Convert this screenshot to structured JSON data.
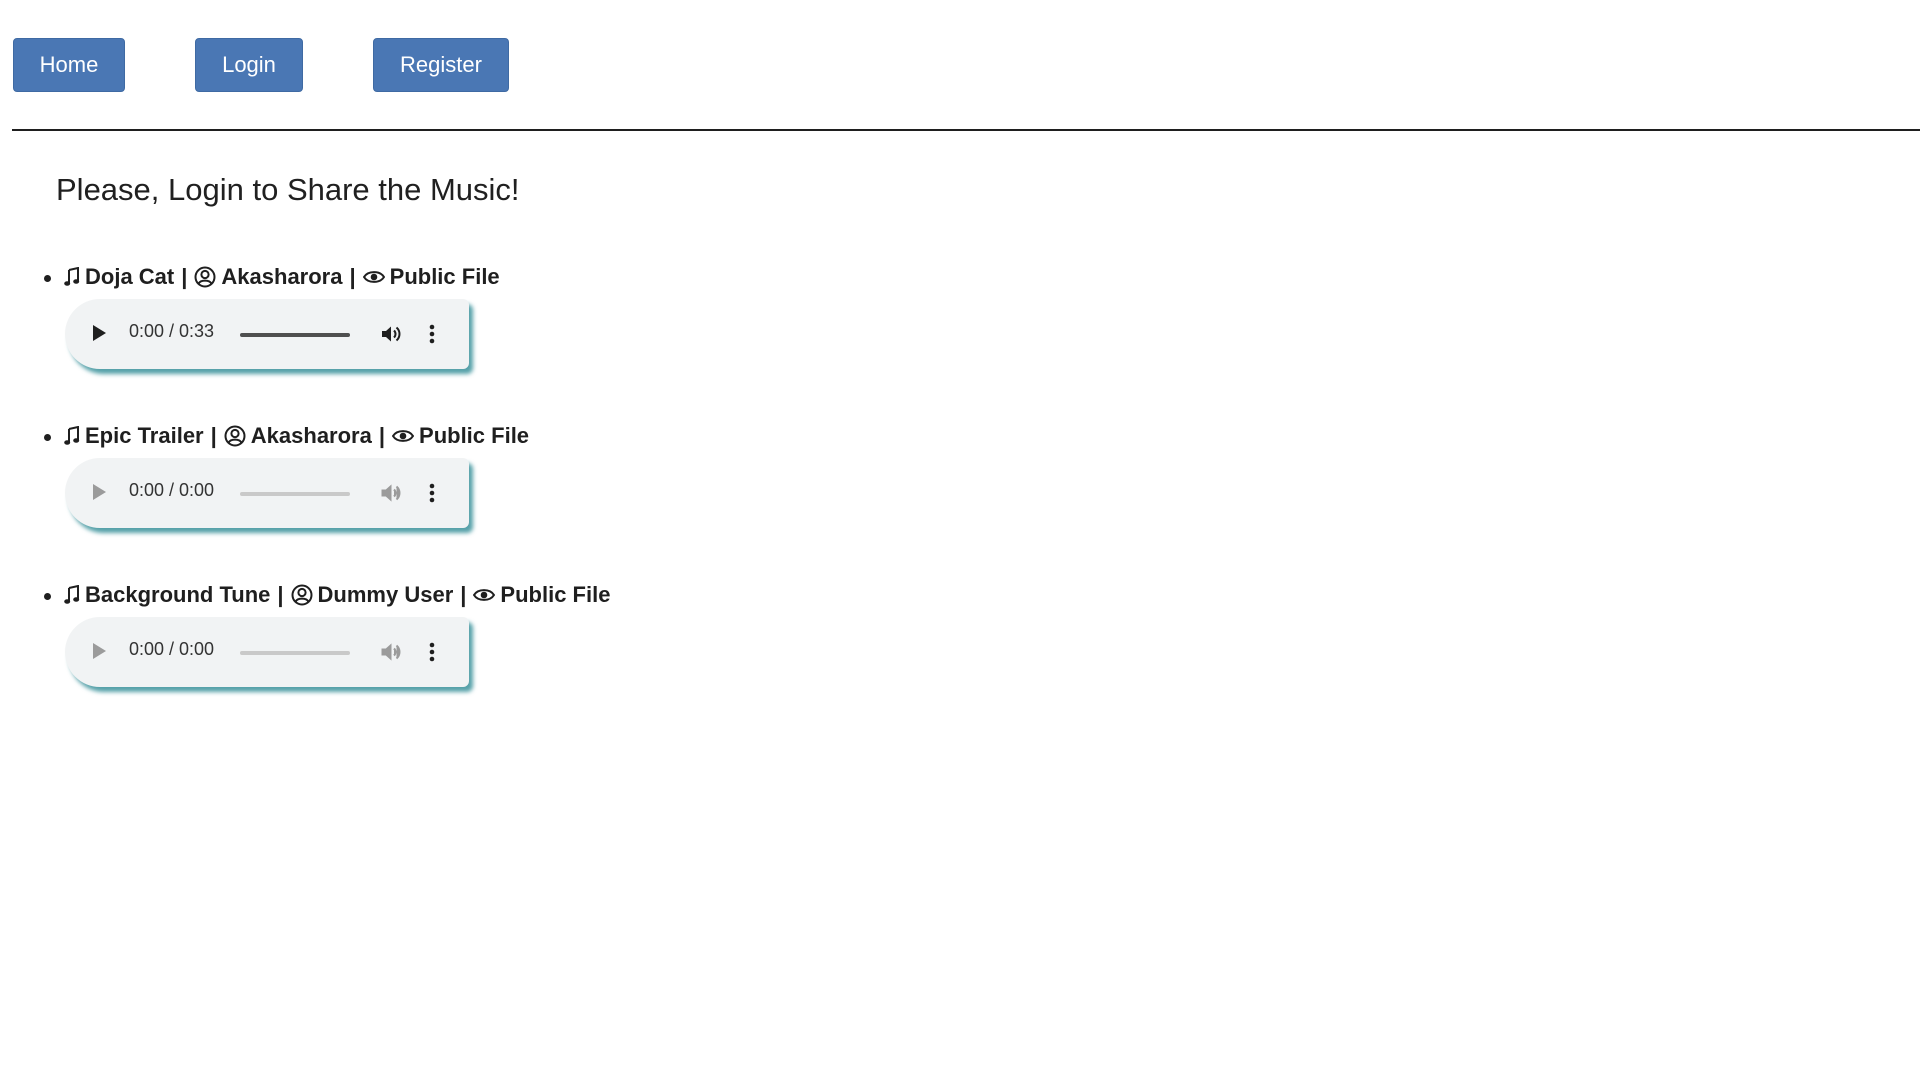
{
  "nav": {
    "home_label": "Home",
    "login_label": "Login",
    "register_label": "Register",
    "button_color": "#4a77b4"
  },
  "main": {
    "heading": "Please, Login to Share the Music!",
    "tracks": [
      {
        "title": "Doja Cat",
        "user": "Akasharora",
        "visibility": "Public File",
        "time": "0:00 / 0:33",
        "progress": 1.0,
        "enabled": true
      },
      {
        "title": "Epic Trailer",
        "user": "Akasharora",
        "visibility": "Public File",
        "time": "0:00 / 0:00",
        "progress": 0,
        "enabled": false
      },
      {
        "title": "Background Tune",
        "user": "Dummy User",
        "visibility": "Public File",
        "time": "0:00 / 0:00",
        "progress": 0,
        "enabled": false
      }
    ],
    "separator": "|",
    "icons": {
      "title": "music-note-icon",
      "user": "user-circle-icon",
      "visibility": "eye-icon"
    }
  }
}
